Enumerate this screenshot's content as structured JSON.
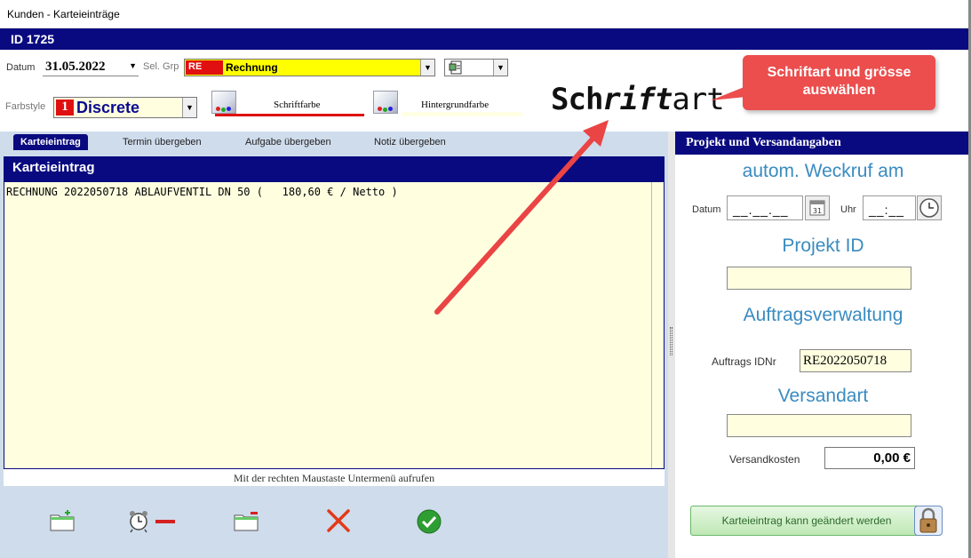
{
  "window": {
    "title": "Kunden - Karteieinträge",
    "id_label": "ID 1725"
  },
  "header": {
    "datum_label": "Datum",
    "datum_value": "31.05.2022",
    "selgrp_label": "Sel. Grp",
    "selgrp_code": "RE",
    "selgrp_value": "Rechnung",
    "farbstyle_label": "Farbstyle",
    "farbstyle_num": "1",
    "farbstyle_value": "Discrete",
    "schriftfarbe_label": "Schriftfarbe",
    "hintergrundfarbe_label": "Hintergrundfarbe",
    "schriftart_label_a": "Sch",
    "schriftart_label_b": "rift",
    "schriftart_label_c": "art"
  },
  "callout": {
    "line1": "Schriftart und grösse",
    "line2": "auswählen"
  },
  "tabs": [
    {
      "label": "Karteieintrag",
      "active": true
    },
    {
      "label": "Termin übergeben",
      "active": false
    },
    {
      "label": "Aufgabe übergeben",
      "active": false
    },
    {
      "label": "Notiz übergeben",
      "active": false
    }
  ],
  "entry": {
    "header": "Karteieintrag",
    "text": "RECHNUNG 2022050718 ABLAUFVENTIL DN 50 (   180,60 € / Netto )",
    "hint": "Mit der rechten Maustaste Untermenü aufrufen"
  },
  "right": {
    "header": "Projekt und Versandangaben",
    "weckruf_title": "autom. Weckruf am",
    "datum_label": "Datum",
    "datum_mask": "__.__.__",
    "uhr_label": "Uhr",
    "uhr_mask": "__:__",
    "projekt_title": "Projekt ID",
    "projekt_value": "",
    "auftrag_title": "Auftragsverwaltung",
    "auftrag_label": "Auftrags IDNr",
    "auftrag_value": "RE2022050718",
    "versand_title": "Versandart",
    "versand_value": "",
    "versandkosten_label": "Versandkosten",
    "versandkosten_value": "0,00 €",
    "status_button": "Karteieintrag kann geändert werden"
  },
  "colors": {
    "navy": "#0a0a80",
    "callout": "#ec4d4d",
    "highlight": "#ffff00",
    "note_bg": "#ffffe0",
    "section_blue": "#3a8bc0"
  }
}
